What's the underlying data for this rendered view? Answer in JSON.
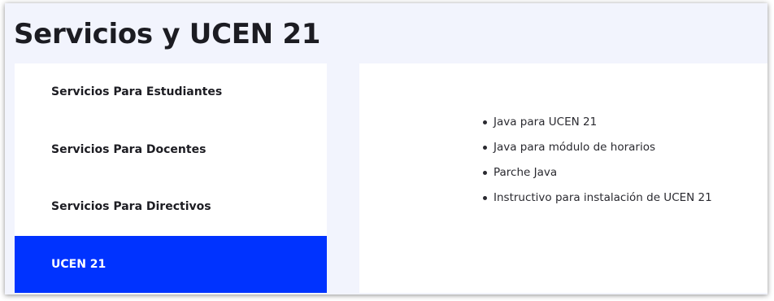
{
  "page": {
    "title": "Servicios y UCEN 21"
  },
  "sidebar": {
    "items": [
      {
        "label": "Servicios Para Estudiantes",
        "active": false
      },
      {
        "label": "Servicios Para Docentes",
        "active": false
      },
      {
        "label": "Servicios Para Directivos",
        "active": false
      },
      {
        "label": "UCEN 21",
        "active": true
      }
    ]
  },
  "content": {
    "links": [
      "Java para UCEN 21",
      "Java para módulo de horarios",
      "Parche Java",
      "Instructivo para instalación de UCEN 21"
    ]
  },
  "colors": {
    "page_background": "#f2f4fd",
    "active_tab": "#0033ff",
    "text": "#1c1c22"
  }
}
